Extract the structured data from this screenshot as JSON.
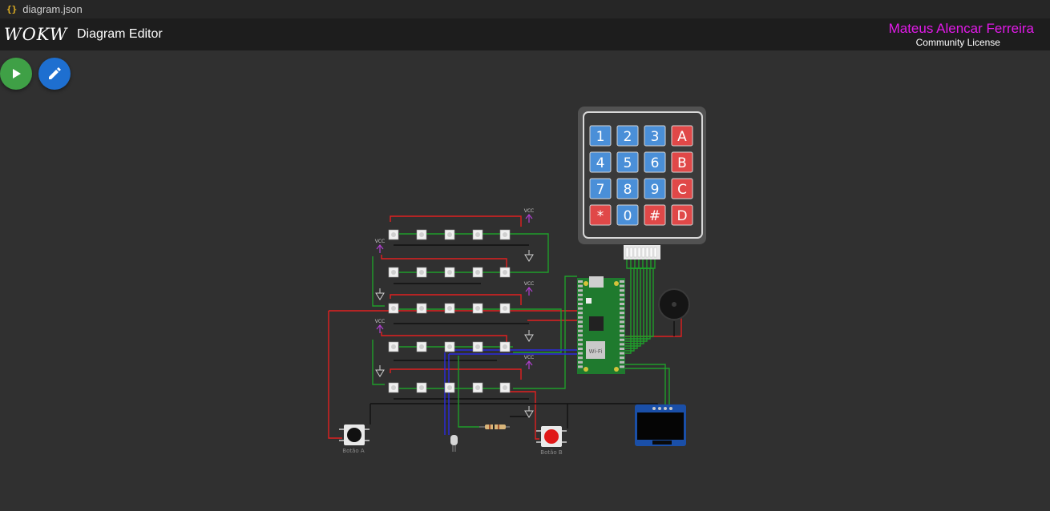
{
  "tab": {
    "icon": "{}",
    "filename": "diagram.json"
  },
  "header": {
    "logo_text": "WOKWi",
    "title": "Diagram Editor"
  },
  "user": {
    "name": "Mateus Alencar Ferreira",
    "license": "Community License"
  },
  "toolbar": {
    "play_icon": "play-icon",
    "edit_icon": "pencil-icon"
  },
  "colors": {
    "accent_user": "#e21ae9",
    "play": "#3fa046",
    "edit": "#1e6fd0",
    "canvas": "#303030"
  },
  "keypad": {
    "keys": [
      [
        "1",
        "2",
        "3",
        "A"
      ],
      [
        "4",
        "5",
        "6",
        "B"
      ],
      [
        "7",
        "8",
        "9",
        "C"
      ],
      [
        "*",
        "0",
        "#",
        "D"
      ]
    ]
  },
  "power_labels": {
    "vcc": "VCC"
  },
  "board": {
    "chip_label": "Wi-Fi"
  },
  "buttons": {
    "a_label": "Botão A",
    "b_label": "Botão B"
  }
}
